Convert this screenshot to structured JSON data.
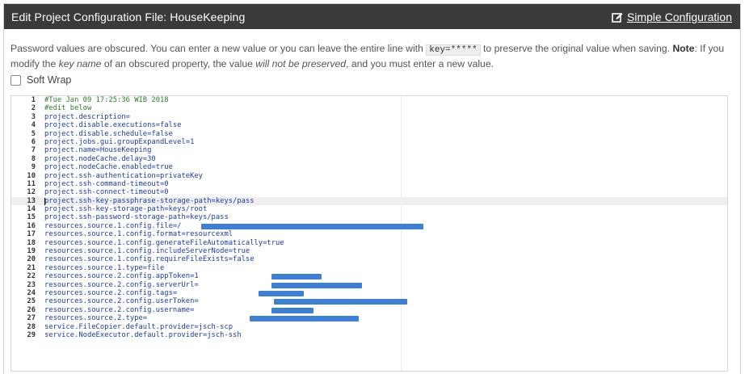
{
  "header": {
    "title": "Edit Project Configuration File: HouseKeeping",
    "simple_config_label": "Simple Configuration",
    "icon": "edit-icon"
  },
  "notice": {
    "part1": "Password values are obscured. You can enter a new value or you can leave the entire line with ",
    "code": "key=*****",
    "part2": " to preserve the original value when saving. ",
    "note_label": "Note",
    "part3": ": If you modify the ",
    "key_name": "key name",
    "part4": " of an obscured property, the value ",
    "will_not": "will not be preserved",
    "part5": ", and you must enter a new value."
  },
  "soft_wrap": {
    "label": "Soft Wrap",
    "checked": false
  },
  "editor": {
    "active_line": 13,
    "lines": [
      {
        "n": "1",
        "text": "#Tue Jan 09 17:25:36 WIB 2018",
        "type": "comment"
      },
      {
        "n": "2",
        "text": "#edit below",
        "type": "comment"
      },
      {
        "n": "3",
        "text": "project.description="
      },
      {
        "n": "4",
        "text": "project.disable.executions=false"
      },
      {
        "n": "5",
        "text": "project.disable.schedule=false"
      },
      {
        "n": "6",
        "text": "project.jobs.gui.groupExpandLevel=1"
      },
      {
        "n": "7",
        "text": "project.name=HouseKeeping"
      },
      {
        "n": "8",
        "text": "project.nodeCache.delay=30"
      },
      {
        "n": "9",
        "text": "project.nodeCache.enabled=true"
      },
      {
        "n": "10",
        "text": "project.ssh-authentication=privateKey"
      },
      {
        "n": "11",
        "text": "project.ssh-command-timeout=0"
      },
      {
        "n": "12",
        "text": "project.ssh-connect-timeout=0"
      },
      {
        "n": "13",
        "text": "project.ssh-key-passphrase-storage-path=keys/pass"
      },
      {
        "n": "14",
        "text": "project.ssh-key-storage-path=keys/root"
      },
      {
        "n": "15",
        "text": "project.ssh-password-storage-path=keys/pass"
      },
      {
        "n": "16",
        "text": "resources.source.1.config.file=/",
        "redacted": true
      },
      {
        "n": "17",
        "text": "resources.source.1.config.format=resourcexml"
      },
      {
        "n": "18",
        "text": "resources.source.1.config.generateFileAutomatically=true"
      },
      {
        "n": "19",
        "text": "resources.source.1.config.includeServerNode=true"
      },
      {
        "n": "20",
        "text": "resources.source.1.config.requireFileExists=false"
      },
      {
        "n": "21",
        "text": "resources.source.1.type=file"
      },
      {
        "n": "22",
        "text": "resources.source.2.config.appToken=1",
        "redacted": true
      },
      {
        "n": "23",
        "text": "resources.source.2.config.serverUrl=",
        "redacted": true
      },
      {
        "n": "24",
        "text": "resources.source.2.config.tags=",
        "redacted": true
      },
      {
        "n": "25",
        "text": "resources.source.2.config.userToken=",
        "redacted": true
      },
      {
        "n": "26",
        "text": "resources.source.2.config.username=",
        "redacted": true
      },
      {
        "n": "27",
        "text": "resources.source.2.type=",
        "redacted": true
      },
      {
        "n": "28",
        "text": "service.FileCopier.default.provider=jsch-scp"
      },
      {
        "n": "29",
        "text": "service.NodeExecutor.default.provider=jsch-ssh"
      }
    ]
  }
}
